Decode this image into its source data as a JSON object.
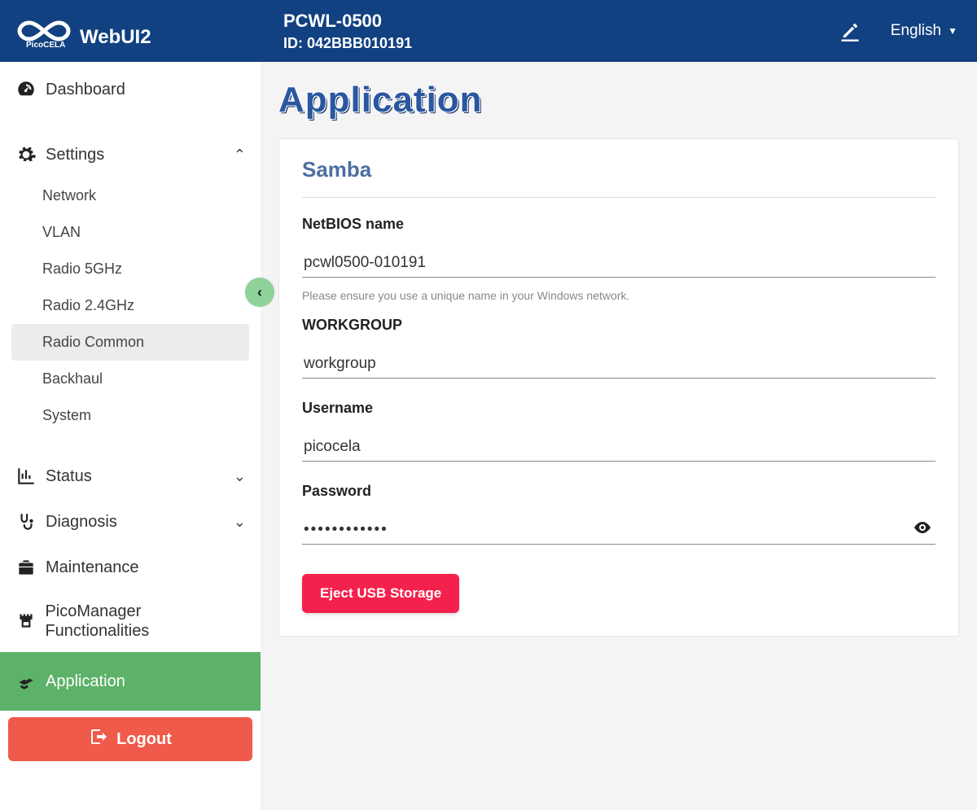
{
  "header": {
    "brand": "WebUI2",
    "brand_sub": "PicoCELA",
    "device_title": "PCWL-0500",
    "device_id_label": "ID: 042BBB010191",
    "language": "English"
  },
  "sidebar": {
    "dashboard": "Dashboard",
    "settings": "Settings",
    "settings_items": {
      "network": "Network",
      "vlan": "VLAN",
      "radio5": "Radio 5GHz",
      "radio24": "Radio 2.4GHz",
      "radio_common": "Radio Common",
      "backhaul": "Backhaul",
      "system": "System"
    },
    "status": "Status",
    "diagnosis": "Diagnosis",
    "maintenance": "Maintenance",
    "picomanager": "PicoManager Functionalities",
    "application": "Application",
    "logout": "Logout"
  },
  "page": {
    "title": "Application",
    "card_title": "Samba",
    "netbios_label": "NetBIOS name",
    "netbios_value": "pcwl0500-010191",
    "netbios_help": "Please ensure you use a unique name in your Windows network.",
    "workgroup_label": "WORKGROUP",
    "workgroup_value": "workgroup",
    "username_label": "Username",
    "username_value": "picocela",
    "password_label": "Password",
    "password_value": "••••••••••••",
    "eject_button": "Eject USB Storage"
  }
}
